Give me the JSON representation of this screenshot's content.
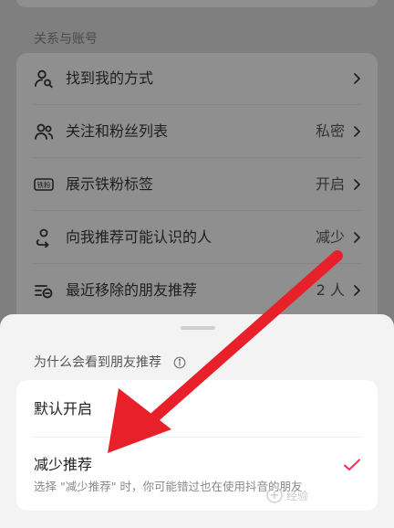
{
  "settings": {
    "section_title": "关系与账号",
    "rows": [
      {
        "icon": "find-me-icon",
        "label": "找到我的方式",
        "value": ""
      },
      {
        "icon": "follow-list-icon",
        "label": "关注和粉丝列表",
        "value": "私密"
      },
      {
        "icon": "fan-badge-icon",
        "label": "展示铁粉标签",
        "value": "开启",
        "badge_text": "铁粉"
      },
      {
        "icon": "recommend-icon",
        "label": "向我推荐可能认识的人",
        "value": "减少"
      },
      {
        "icon": "removed-friends-icon",
        "label": "最近移除的朋友推荐",
        "value": "2 人"
      }
    ]
  },
  "sheet": {
    "title": "为什么会看到朋友推荐",
    "options": [
      {
        "label": "默认开启",
        "description": "",
        "selected": false
      },
      {
        "label": "减少推荐",
        "description": "选择 \"减少推荐\" 时，你可能错过也在使用抖音的朋友",
        "selected": true
      }
    ]
  },
  "watermark": "经验",
  "colors": {
    "accent": "#fe2c55",
    "annotation_arrow": "#e8202a"
  }
}
